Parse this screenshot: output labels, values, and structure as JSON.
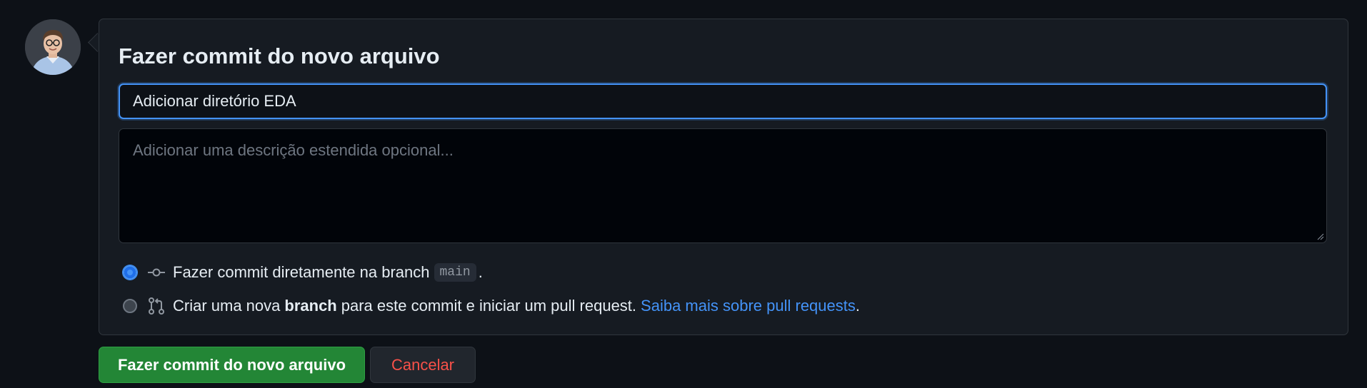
{
  "avatar": {
    "icon": "user-avatar-icon"
  },
  "commit_form": {
    "title": "Fazer commit do novo arquivo",
    "summary_value": "Adicionar diretório EDA",
    "description_placeholder": "Adicionar uma descrição estendida opcional...",
    "options": [
      {
        "selected": true,
        "icon": "git-commit-icon",
        "text_before": "Fazer commit diretamente na branch",
        "branch": "main",
        "text_after": "."
      },
      {
        "selected": false,
        "icon": "git-pull-request-icon",
        "text_before": "Criar uma nova",
        "bold": "branch",
        "text_middle": "para este commit e iniciar um pull request.",
        "link": "Saiba mais sobre pull requests",
        "text_after": "."
      }
    ]
  },
  "actions": {
    "commit_label": "Fazer commit do novo arquivo",
    "cancel_label": "Cancelar"
  },
  "colors": {
    "background": "#0d1117",
    "panel": "#161b22",
    "accent_blue": "#4493f8",
    "commit_green": "#238636",
    "cancel_red": "#f85149"
  }
}
